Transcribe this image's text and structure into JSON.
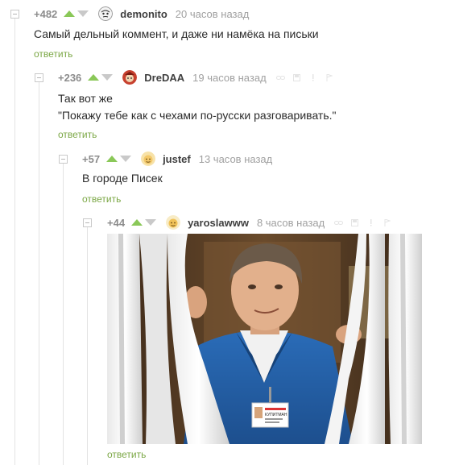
{
  "comments": [
    {
      "rating": "+482",
      "user": "demonito",
      "time": "20 часов назад",
      "text": [
        "Самый дельный коммент, и даже ни намёка на письки"
      ],
      "reply": "ответить"
    },
    {
      "rating": "+236",
      "user": "DreDAA",
      "time": "19 часов назад",
      "text": [
        "Так вот же",
        "\"Покажу тебе как с чехами по-русски разговаривать.\""
      ],
      "reply": "ответить"
    },
    {
      "rating": "+57",
      "user": "justef",
      "time": "13 часов назад",
      "text": [
        "В городе Писек"
      ],
      "reply": "ответить"
    },
    {
      "rating": "+44",
      "user": "yaroslawww",
      "time": "8 часов назад",
      "text": [],
      "reply": "ответить"
    }
  ],
  "photo": {
    "badge_text": "КУПИТМАН"
  },
  "colors": {
    "upvote": "#8ac858",
    "downvote": "#c9c9c9",
    "reply_link": "#7ba745",
    "timestamp": "#a0a0a0",
    "rating": "#8c8c8c",
    "text": "#2b2b2b"
  },
  "icons": [
    "collapse-icon",
    "upvote-arrow-icon",
    "downvote-arrow-icon",
    "avatar",
    "link-icon",
    "save-icon",
    "exclamation-icon",
    "flag-icon"
  ]
}
